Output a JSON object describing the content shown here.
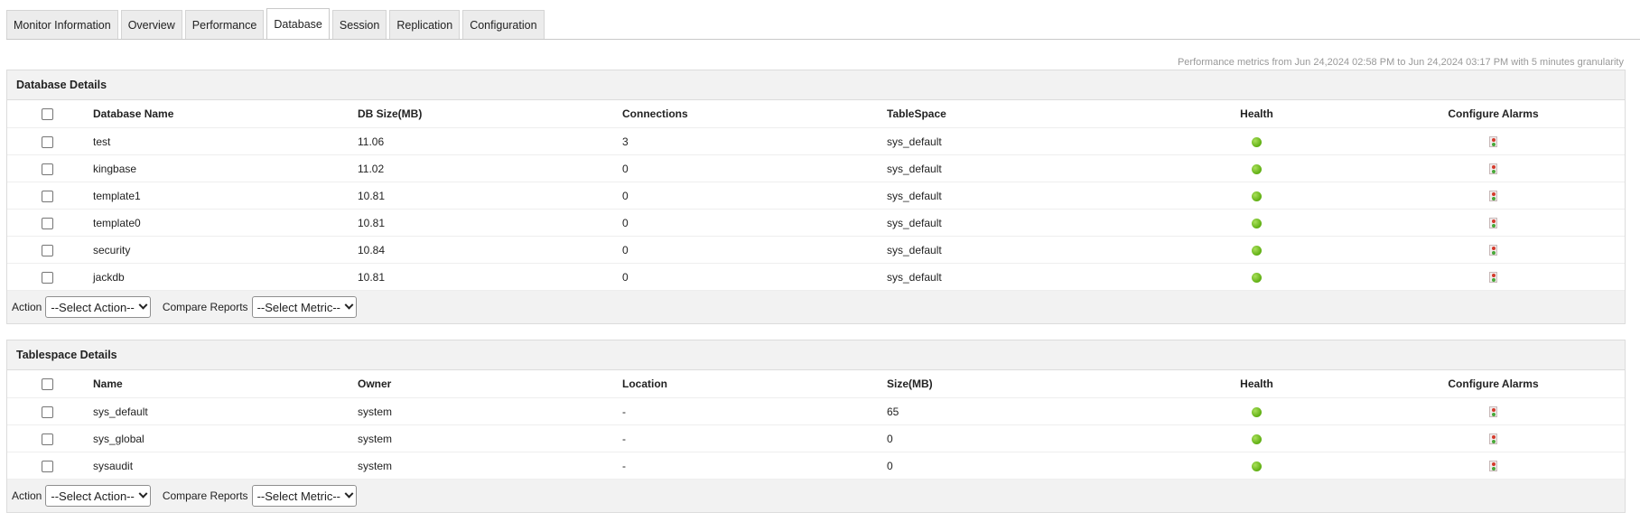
{
  "tabs": [
    {
      "label": "Monitor Information",
      "active": false
    },
    {
      "label": "Overview",
      "active": false
    },
    {
      "label": "Performance",
      "active": false
    },
    {
      "label": "Database",
      "active": true
    },
    {
      "label": "Session",
      "active": false
    },
    {
      "label": "Replication",
      "active": false
    },
    {
      "label": "Configuration",
      "active": false
    }
  ],
  "perf_note": "Performance metrics from Jun 24,2024 02:58 PM to Jun 24,2024 03:17 PM with 5 minutes granularity",
  "database_details": {
    "title": "Database Details",
    "headers": {
      "name": "Database Name",
      "size": "DB Size(MB)",
      "connections": "Connections",
      "tablespace": "TableSpace",
      "health": "Health",
      "alarms": "Configure Alarms"
    },
    "rows": [
      {
        "name": "test",
        "size": "11.06",
        "connections": "3",
        "tablespace": "sys_default"
      },
      {
        "name": "kingbase",
        "size": "11.02",
        "connections": "0",
        "tablespace": "sys_default"
      },
      {
        "name": "template1",
        "size": "10.81",
        "connections": "0",
        "tablespace": "sys_default"
      },
      {
        "name": "template0",
        "size": "10.81",
        "connections": "0",
        "tablespace": "sys_default"
      },
      {
        "name": "security",
        "size": "10.84",
        "connections": "0",
        "tablespace": "sys_default"
      },
      {
        "name": "jackdb",
        "size": "10.81",
        "connections": "0",
        "tablespace": "sys_default"
      }
    ],
    "action_label": "Action",
    "action_select": "--Select Action--",
    "compare_label": "Compare Reports",
    "compare_select": "--Select Metric--"
  },
  "tablespace_details": {
    "title": "Tablespace Details",
    "headers": {
      "name": "Name",
      "owner": "Owner",
      "location": "Location",
      "size": "Size(MB)",
      "health": "Health",
      "alarms": "Configure Alarms"
    },
    "rows": [
      {
        "name": "sys_default",
        "owner": "system",
        "location": "-",
        "size": "65"
      },
      {
        "name": "sys_global",
        "owner": "system",
        "location": "-",
        "size": "0"
      },
      {
        "name": "sysaudit",
        "owner": "system",
        "location": "-",
        "size": "0"
      }
    ],
    "action_label": "Action",
    "action_select": "--Select Action--",
    "compare_label": "Compare Reports",
    "compare_select": "--Select Metric--"
  },
  "colors": {
    "health_ok": "#7cc623",
    "panel_header_bg": "#f2f2f2",
    "note_text": "#999999"
  },
  "icons": {
    "health": "green-status-dot-icon",
    "alarm": "traffic-light-alarm-icon"
  }
}
